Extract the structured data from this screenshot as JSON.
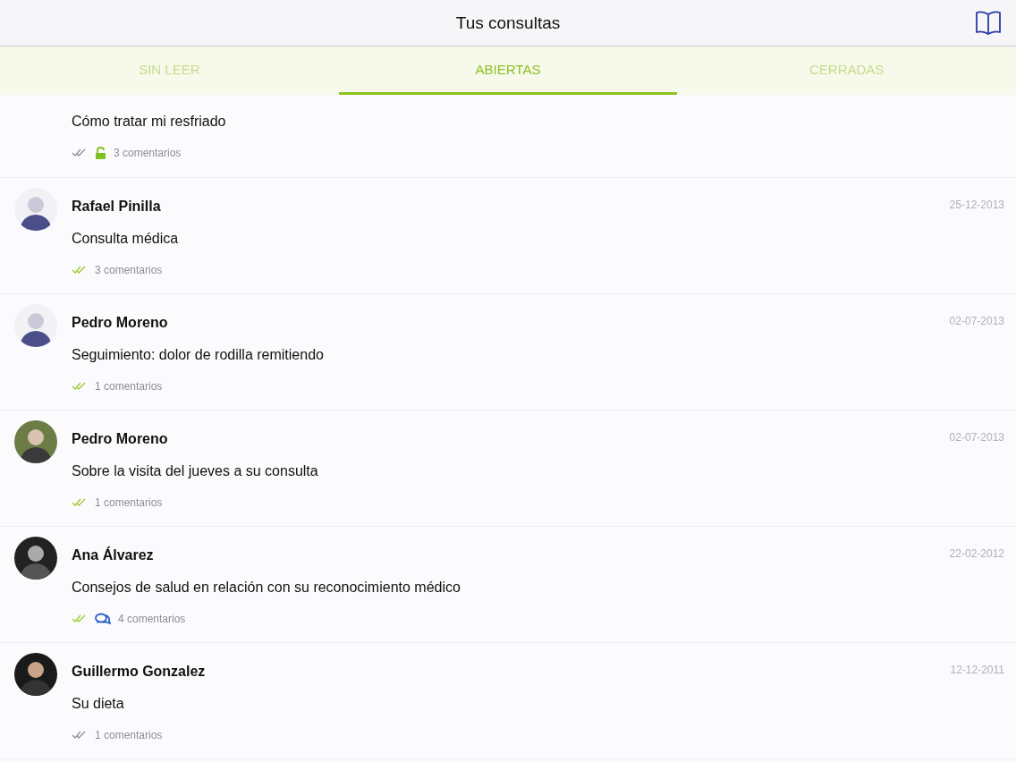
{
  "header": {
    "title": "Tus consultas"
  },
  "tabs": [
    {
      "label": "SIN LEER",
      "selected": false
    },
    {
      "label": "ABIERTAS",
      "selected": true
    },
    {
      "label": "CERRADAS",
      "selected": false
    }
  ],
  "consultations": [
    {
      "subject": "Cómo tratar mi resfriado",
      "comments": "3 comentarios",
      "read": false,
      "unlocked": true
    },
    {
      "name": "Rafael Pinilla",
      "date": "25-12-2013",
      "subject": "Consulta médica",
      "comments": "3 comentarios",
      "read": true
    },
    {
      "name": "Pedro Moreno",
      "date": "02-07-2013",
      "subject": "Seguimiento: dolor de rodilla remitiendo",
      "comments": "1 comentarios",
      "read": true
    },
    {
      "name": "Pedro Moreno",
      "date": "02-07-2013",
      "subject": "Sobre la visita del jueves a su consulta",
      "comments": "1 comentarios",
      "read": true
    },
    {
      "name": "Ana Álvarez",
      "date": "22-02-2012",
      "subject": "Consejos de salud en relación con su reconocimiento médico",
      "comments": "4 comentarios",
      "read": true,
      "new_comments": true
    },
    {
      "name": "Guillermo Gonzalez",
      "date": "12-12-2011",
      "subject": "Su dieta",
      "comments": "1 comentarios",
      "read": false
    }
  ]
}
